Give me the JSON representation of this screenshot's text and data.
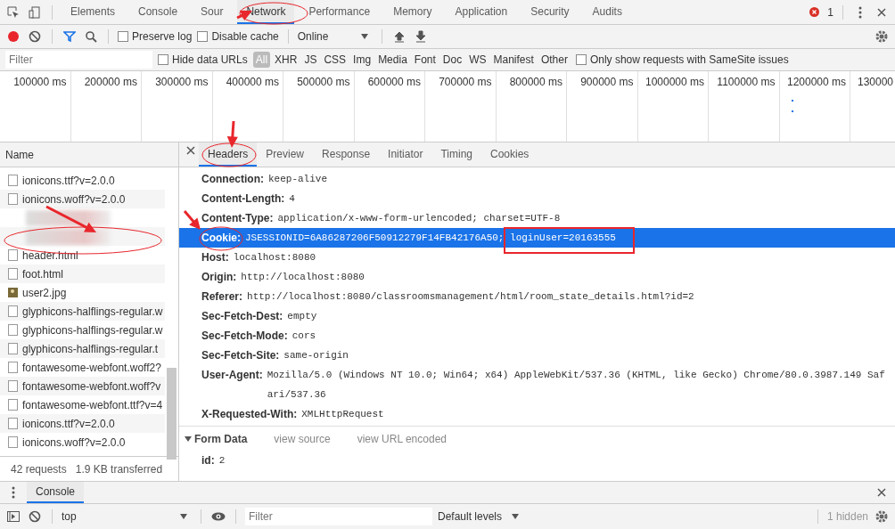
{
  "panel_tabs": [
    {
      "label": "Elements",
      "selected": false
    },
    {
      "label": "Console",
      "selected": false
    },
    {
      "label": "Sour",
      "selected": false
    },
    {
      "label": "Network",
      "selected": true
    },
    {
      "label": "Performance",
      "selected": false
    },
    {
      "label": "Memory",
      "selected": false
    },
    {
      "label": "Application",
      "selected": false
    },
    {
      "label": "Security",
      "selected": false
    },
    {
      "label": "Audits",
      "selected": false
    }
  ],
  "error_count": "1",
  "toolbar": {
    "recording": true,
    "preserve_log": {
      "label": "Preserve log",
      "checked": false
    },
    "disable_cache": {
      "label": "Disable cache",
      "checked": false
    },
    "throttling": "Online"
  },
  "filter_bar": {
    "placeholder": "Filter",
    "hide_data_urls": {
      "label": "Hide data URLs",
      "checked": false
    },
    "types": [
      {
        "label": "All",
        "selected": true
      },
      {
        "label": "XHR",
        "selected": false
      },
      {
        "label": "JS",
        "selected": false
      },
      {
        "label": "CSS",
        "selected": false
      },
      {
        "label": "Img",
        "selected": false
      },
      {
        "label": "Media",
        "selected": false
      },
      {
        "label": "Font",
        "selected": false
      },
      {
        "label": "Doc",
        "selected": false
      },
      {
        "label": "WS",
        "selected": false
      },
      {
        "label": "Manifest",
        "selected": false
      },
      {
        "label": "Other",
        "selected": false
      }
    ],
    "samesite": {
      "label": "Only show requests with SameSite issues",
      "checked": false
    }
  },
  "timeline_ticks": [
    "100000 ms",
    "200000 ms",
    "300000 ms",
    "400000 ms",
    "500000 ms",
    "600000 ms",
    "700000 ms",
    "800000 ms",
    "900000 ms",
    "1000000 ms",
    "1100000 ms",
    "1200000 ms",
    "130000"
  ],
  "requests_header": "Name",
  "requests": [
    {
      "kind": "file",
      "name": "ionicons.ttf?v=2.0.0"
    },
    {
      "kind": "file",
      "name": "ionicons.woff?v=2.0.0"
    },
    {
      "kind": "blurred"
    },
    {
      "kind": "blurred"
    },
    {
      "kind": "file",
      "name": "header.html"
    },
    {
      "kind": "file",
      "name": "foot.html"
    },
    {
      "kind": "image",
      "name": "user2.jpg"
    },
    {
      "kind": "file",
      "name": "glyphicons-halflings-regular.w"
    },
    {
      "kind": "file",
      "name": "glyphicons-halflings-regular.w"
    },
    {
      "kind": "file",
      "name": "glyphicons-halflings-regular.t"
    },
    {
      "kind": "file",
      "name": "fontawesome-webfont.woff2?"
    },
    {
      "kind": "file",
      "name": "fontawesome-webfont.woff?v"
    },
    {
      "kind": "file",
      "name": "fontawesome-webfont.ttf?v=4"
    },
    {
      "kind": "file",
      "name": "ionicons.ttf?v=2.0.0"
    },
    {
      "kind": "file",
      "name": "ionicons.woff?v=2.0.0"
    }
  ],
  "summary": [
    "42 requests",
    "1.9 KB transferred"
  ],
  "detail_tabs": [
    {
      "label": "Headers",
      "selected": true
    },
    {
      "label": "Preview",
      "selected": false
    },
    {
      "label": "Response",
      "selected": false
    },
    {
      "label": "Initiator",
      "selected": false
    },
    {
      "label": "Timing",
      "selected": false
    },
    {
      "label": "Cookies",
      "selected": false
    }
  ],
  "headers": [
    {
      "name": "Connection:",
      "value": "keep-alive",
      "selected": false
    },
    {
      "name": "Content-Length:",
      "value": "4",
      "selected": false
    },
    {
      "name": "Content-Type:",
      "value": "application/x-www-form-urlencoded; charset=UTF-8",
      "selected": false
    },
    {
      "name": "Cookie:",
      "value": "JSESSIONID=6A86287206F50912279F14FB42176A50; loginUser=20163555",
      "selected": true
    },
    {
      "name": "Host:",
      "value": "localhost:8080",
      "selected": false
    },
    {
      "name": "Origin:",
      "value": "http://localhost:8080",
      "selected": false
    },
    {
      "name": "Referer:",
      "value": "http://localhost:8080/classroomsmanagement/html/room_state_details.html?id=2",
      "selected": false
    },
    {
      "name": "Sec-Fetch-Dest:",
      "value": "empty",
      "selected": false
    },
    {
      "name": "Sec-Fetch-Mode:",
      "value": "cors",
      "selected": false
    },
    {
      "name": "Sec-Fetch-Site:",
      "value": "same-origin",
      "selected": false
    },
    {
      "name": "User-Agent:",
      "value": "Mozilla/5.0 (Windows NT 10.0; Win64; x64) AppleWebKit/537.36 (KHTML, like Gecko) Chrome/80.0.3987.149 Safari/537.36",
      "selected": false
    },
    {
      "name": "X-Requested-With:",
      "value": "XMLHttpRequest",
      "selected": false
    }
  ],
  "form_data": {
    "title": "Form Data",
    "expanded": true,
    "links": [
      "view source",
      "view URL encoded"
    ],
    "fields": [
      {
        "name": "id:",
        "value": "2"
      }
    ]
  },
  "drawer": {
    "tabs": [
      {
        "label": "Console",
        "selected": true
      }
    ],
    "context": "top",
    "placeholder": "Filter",
    "levels": "Default levels",
    "hidden": "1 hidden"
  }
}
